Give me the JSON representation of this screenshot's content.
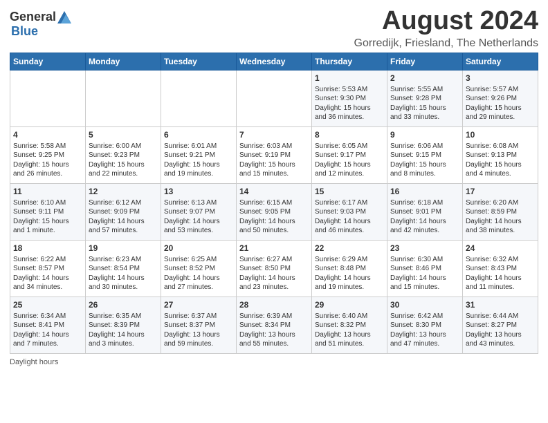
{
  "logo": {
    "general": "General",
    "blue": "Blue"
  },
  "title": "August 2024",
  "subtitle": "Gorredijk, Friesland, The Netherlands",
  "footer": "Daylight hours",
  "days_of_week": [
    "Sunday",
    "Monday",
    "Tuesday",
    "Wednesday",
    "Thursday",
    "Friday",
    "Saturday"
  ],
  "weeks": [
    [
      {
        "day": "",
        "info": ""
      },
      {
        "day": "",
        "info": ""
      },
      {
        "day": "",
        "info": ""
      },
      {
        "day": "",
        "info": ""
      },
      {
        "day": "1",
        "info": "Sunrise: 5:53 AM\nSunset: 9:30 PM\nDaylight: 15 hours and 36 minutes."
      },
      {
        "day": "2",
        "info": "Sunrise: 5:55 AM\nSunset: 9:28 PM\nDaylight: 15 hours and 33 minutes."
      },
      {
        "day": "3",
        "info": "Sunrise: 5:57 AM\nSunset: 9:26 PM\nDaylight: 15 hours and 29 minutes."
      }
    ],
    [
      {
        "day": "4",
        "info": "Sunrise: 5:58 AM\nSunset: 9:25 PM\nDaylight: 15 hours and 26 minutes."
      },
      {
        "day": "5",
        "info": "Sunrise: 6:00 AM\nSunset: 9:23 PM\nDaylight: 15 hours and 22 minutes."
      },
      {
        "day": "6",
        "info": "Sunrise: 6:01 AM\nSunset: 9:21 PM\nDaylight: 15 hours and 19 minutes."
      },
      {
        "day": "7",
        "info": "Sunrise: 6:03 AM\nSunset: 9:19 PM\nDaylight: 15 hours and 15 minutes."
      },
      {
        "day": "8",
        "info": "Sunrise: 6:05 AM\nSunset: 9:17 PM\nDaylight: 15 hours and 12 minutes."
      },
      {
        "day": "9",
        "info": "Sunrise: 6:06 AM\nSunset: 9:15 PM\nDaylight: 15 hours and 8 minutes."
      },
      {
        "day": "10",
        "info": "Sunrise: 6:08 AM\nSunset: 9:13 PM\nDaylight: 15 hours and 4 minutes."
      }
    ],
    [
      {
        "day": "11",
        "info": "Sunrise: 6:10 AM\nSunset: 9:11 PM\nDaylight: 15 hours and 1 minute."
      },
      {
        "day": "12",
        "info": "Sunrise: 6:12 AM\nSunset: 9:09 PM\nDaylight: 14 hours and 57 minutes."
      },
      {
        "day": "13",
        "info": "Sunrise: 6:13 AM\nSunset: 9:07 PM\nDaylight: 14 hours and 53 minutes."
      },
      {
        "day": "14",
        "info": "Sunrise: 6:15 AM\nSunset: 9:05 PM\nDaylight: 14 hours and 50 minutes."
      },
      {
        "day": "15",
        "info": "Sunrise: 6:17 AM\nSunset: 9:03 PM\nDaylight: 14 hours and 46 minutes."
      },
      {
        "day": "16",
        "info": "Sunrise: 6:18 AM\nSunset: 9:01 PM\nDaylight: 14 hours and 42 minutes."
      },
      {
        "day": "17",
        "info": "Sunrise: 6:20 AM\nSunset: 8:59 PM\nDaylight: 14 hours and 38 minutes."
      }
    ],
    [
      {
        "day": "18",
        "info": "Sunrise: 6:22 AM\nSunset: 8:57 PM\nDaylight: 14 hours and 34 minutes."
      },
      {
        "day": "19",
        "info": "Sunrise: 6:23 AM\nSunset: 8:54 PM\nDaylight: 14 hours and 30 minutes."
      },
      {
        "day": "20",
        "info": "Sunrise: 6:25 AM\nSunset: 8:52 PM\nDaylight: 14 hours and 27 minutes."
      },
      {
        "day": "21",
        "info": "Sunrise: 6:27 AM\nSunset: 8:50 PM\nDaylight: 14 hours and 23 minutes."
      },
      {
        "day": "22",
        "info": "Sunrise: 6:29 AM\nSunset: 8:48 PM\nDaylight: 14 hours and 19 minutes."
      },
      {
        "day": "23",
        "info": "Sunrise: 6:30 AM\nSunset: 8:46 PM\nDaylight: 14 hours and 15 minutes."
      },
      {
        "day": "24",
        "info": "Sunrise: 6:32 AM\nSunset: 8:43 PM\nDaylight: 14 hours and 11 minutes."
      }
    ],
    [
      {
        "day": "25",
        "info": "Sunrise: 6:34 AM\nSunset: 8:41 PM\nDaylight: 14 hours and 7 minutes."
      },
      {
        "day": "26",
        "info": "Sunrise: 6:35 AM\nSunset: 8:39 PM\nDaylight: 14 hours and 3 minutes."
      },
      {
        "day": "27",
        "info": "Sunrise: 6:37 AM\nSunset: 8:37 PM\nDaylight: 13 hours and 59 minutes."
      },
      {
        "day": "28",
        "info": "Sunrise: 6:39 AM\nSunset: 8:34 PM\nDaylight: 13 hours and 55 minutes."
      },
      {
        "day": "29",
        "info": "Sunrise: 6:40 AM\nSunset: 8:32 PM\nDaylight: 13 hours and 51 minutes."
      },
      {
        "day": "30",
        "info": "Sunrise: 6:42 AM\nSunset: 8:30 PM\nDaylight: 13 hours and 47 minutes."
      },
      {
        "day": "31",
        "info": "Sunrise: 6:44 AM\nSunset: 8:27 PM\nDaylight: 13 hours and 43 minutes."
      }
    ]
  ]
}
